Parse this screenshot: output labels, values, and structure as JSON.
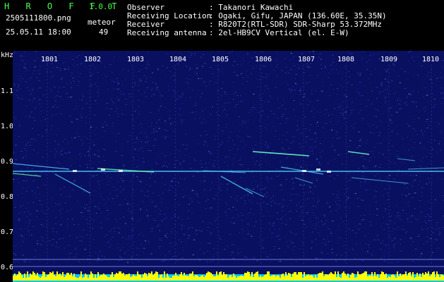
{
  "header": {
    "app_name": "H R O F F T",
    "version": "1.0.0",
    "filename": "2505111800.png",
    "datetime": "25.05.11 18:00",
    "meteor_label": "meteor",
    "meteor_count": "49",
    "info": [
      {
        "label": "Observer",
        "value": ": Takanori Kawachi"
      },
      {
        "label": "Receiving Location",
        "value": ": Ogaki, Gifu, JAPAN (136.60E, 35.35N)"
      },
      {
        "label": "Receiver",
        "value": ": R820T2(RTL-SDR) SDR-Sharp 53.372MHz"
      },
      {
        "label": "Receiving antenna",
        "value": ": 2el-HB9CV Vertical (el. E-W)"
      }
    ]
  },
  "chart_data": {
    "type": "heatmap",
    "ylabel": "kHz",
    "y_ticks": [
      "1.1",
      "1.0",
      "0.9",
      "0.8",
      "0.7",
      "0.6"
    ],
    "x_ticks": [
      "1801",
      "1802",
      "1803",
      "1804",
      "1805",
      "1806",
      "1807",
      "1808",
      "1809",
      "1810"
    ],
    "colors": {
      "background": "#0a1060",
      "noise": "#2a3cc0",
      "signal": "#4dd0ff",
      "strong": "#ffffff",
      "bar": "#ffff00",
      "bar_base": "#00c8ff"
    }
  }
}
